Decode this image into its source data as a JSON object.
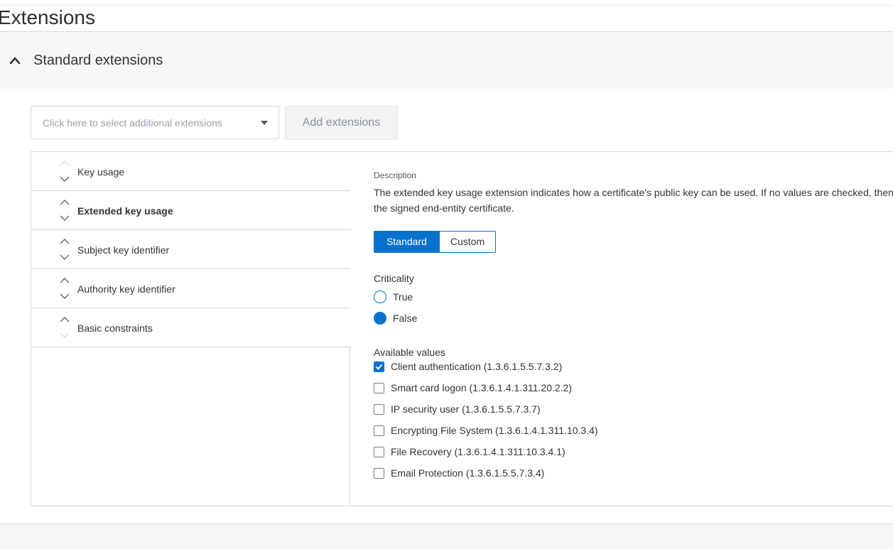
{
  "page": {
    "title": "Extensions"
  },
  "section": {
    "title": "Standard extensions",
    "expanded": true,
    "chevron_icon": "chevron-up-icon"
  },
  "selector": {
    "placeholder": "Click here to select additional extensions",
    "caret_icon": "caret-down-icon"
  },
  "add_button": {
    "label": "Add extensions",
    "enabled": false
  },
  "extensions": [
    {
      "label": "Key usage",
      "active": false
    },
    {
      "label": "Extended key usage",
      "active": true
    },
    {
      "label": "Subject key identifier",
      "active": false
    },
    {
      "label": "Authority key identifier",
      "active": false
    },
    {
      "label": "Basic constraints",
      "active": false
    }
  ],
  "details": {
    "description_label": "Description",
    "description_text": "The extended key usage extension indicates how a certificate's public key can be used. If no values are checked, then the signed end-entity certificate.",
    "mode_toggle": {
      "standard": "Standard",
      "custom": "Custom",
      "selected": "Standard"
    },
    "criticality": {
      "label": "Criticality",
      "options": [
        {
          "label": "True",
          "checked": false
        },
        {
          "label": "False",
          "checked": true
        }
      ]
    },
    "available_values": {
      "label": "Available values",
      "items": [
        {
          "label": "Client authentication (1.3.6.1.5.5.7.3.2)",
          "checked": true
        },
        {
          "label": "Smart card logon (1.3.6.1.4.1.311.20.2.2)",
          "checked": false
        },
        {
          "label": "IP security user (1.3.6.1.5.5.7.3.7)",
          "checked": false
        },
        {
          "label": "Encrypting File System (1.3.6.1.4.1.311.10.3.4)",
          "checked": false
        },
        {
          "label": "File Recovery (1.3.6.1.4.1.311.10.3.4.1)",
          "checked": false
        },
        {
          "label": "Email Protection (1.3.6.1.5.5.7.3.4)",
          "checked": false
        }
      ]
    }
  },
  "colors": {
    "accent": "#0572ce",
    "header_bg": "#f6f7f8",
    "border": "#d4d6d9"
  }
}
